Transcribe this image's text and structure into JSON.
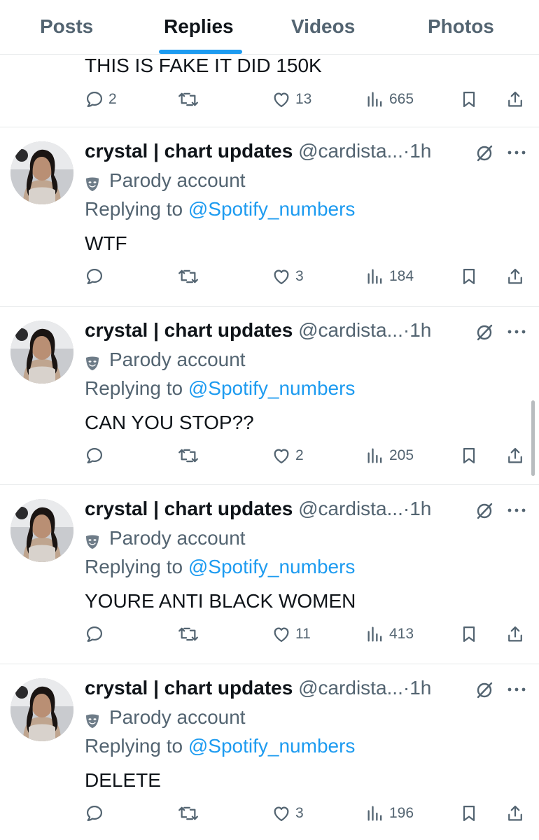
{
  "tabs": [
    {
      "label": "Posts",
      "active": false
    },
    {
      "label": "Replies",
      "active": true
    },
    {
      "label": "Videos",
      "active": false
    },
    {
      "label": "Photos",
      "active": false
    }
  ],
  "top_item": {
    "text": "THIS IS FAKE IT DID 150K",
    "replies": "2",
    "reposts": "",
    "likes": "13",
    "views": "665"
  },
  "replies": [
    {
      "name": "crystal | chart updates",
      "handle": "@cardista...",
      "time": "1h",
      "parody_label": "Parody account",
      "replying_prefix": "Replying to",
      "mention": "@Spotify_numbers",
      "text": "WTF",
      "replies": "",
      "likes": "3",
      "views": "184"
    },
    {
      "name": "crystal | chart updates",
      "handle": "@cardista...",
      "time": "1h",
      "parody_label": "Parody account",
      "replying_prefix": "Replying to",
      "mention": "@Spotify_numbers",
      "text": "CAN YOU STOP??",
      "replies": "",
      "likes": "2",
      "views": "205"
    },
    {
      "name": "crystal | chart updates",
      "handle": "@cardista...",
      "time": "1h",
      "parody_label": "Parody account",
      "replying_prefix": "Replying to",
      "mention": "@Spotify_numbers",
      "text": "YOURE ANTI BLACK WOMEN",
      "replies": "",
      "likes": "11",
      "views": "413"
    },
    {
      "name": "crystal | chart updates",
      "handle": "@cardista...",
      "time": "1h",
      "parody_label": "Parody account",
      "replying_prefix": "Replying to",
      "mention": "@Spotify_numbers",
      "text": "DELETE",
      "replies": "",
      "likes": "3",
      "views": "196"
    }
  ],
  "dot": "·",
  "icons": {
    "reply": "reply-icon",
    "repost": "repost-icon",
    "like": "heart-icon",
    "views": "views-chart-icon",
    "bookmark": "bookmark-icon",
    "share": "share-icon",
    "grok": "grok-icon",
    "more": "more-icon",
    "parody": "parody-mask-icon"
  },
  "colors": {
    "accent": "#1d9bf0",
    "text": "#0f1419",
    "secondary": "#536471",
    "divider": "#e6e8ea"
  }
}
